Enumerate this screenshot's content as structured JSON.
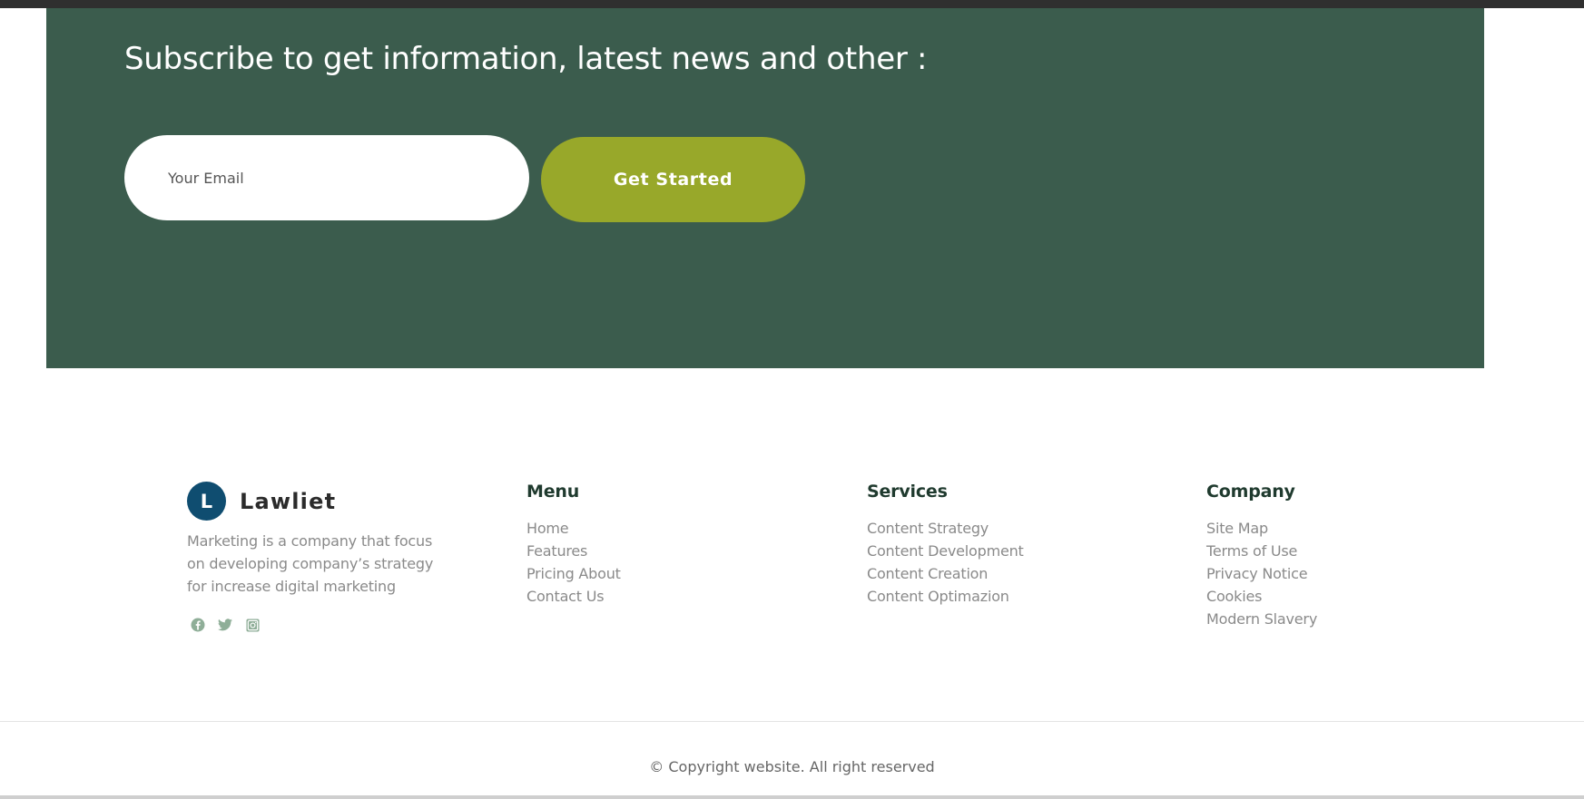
{
  "subscribe": {
    "title": "Subscribe to get information, latest news and other :",
    "email_placeholder": "Your Email",
    "button_label": "Get Started"
  },
  "brand": {
    "logo_letter": "L",
    "name": "Lawliet",
    "description": "Marketing is a company that focus on developing company’s strategy for increase digital marketing",
    "social_icons": [
      "facebook-icon",
      "twitter-icon",
      "instagram-icon"
    ]
  },
  "footer": {
    "menu": {
      "heading": "Menu",
      "items": [
        "Home",
        "Features",
        "Pricing About",
        "Contact Us"
      ]
    },
    "services": {
      "heading": "Services",
      "items": [
        "Content Strategy",
        "Content Development",
        "Content Creation",
        "Content Optimazion"
      ]
    },
    "company": {
      "heading": "Company",
      "items": [
        "Site Map",
        "Terms of Use",
        "Privacy Notice",
        "Cookies",
        "Modern Slavery"
      ]
    }
  },
  "copyright": "© Copyright website. All right reserved",
  "colors": {
    "subscribe_bg": "#3b5c4d",
    "button_bg": "#98a82a",
    "logo_bg": "#0f4d70",
    "heading_text": "#1f3a2e",
    "link_text": "#8a8a8a",
    "social_icon": "#8fae98"
  }
}
